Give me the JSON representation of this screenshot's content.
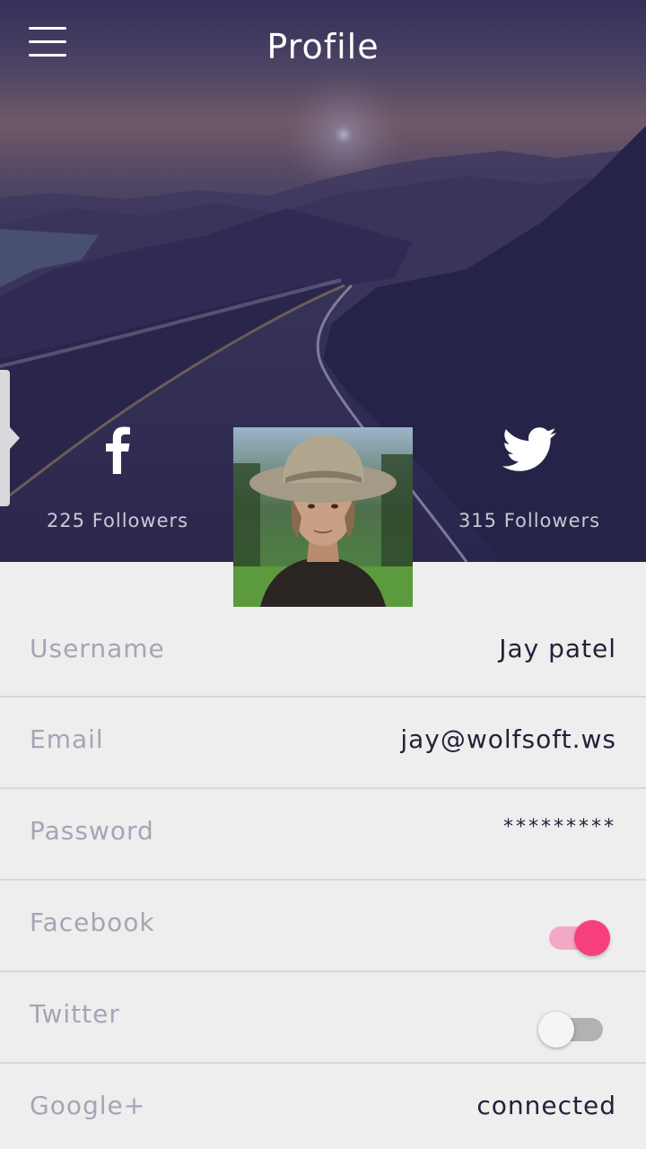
{
  "header": {
    "title": "Profile",
    "menu_icon": "hamburger-menu-icon"
  },
  "social": {
    "facebook": {
      "icon": "facebook-icon",
      "followers": "225 Followers"
    },
    "twitter": {
      "icon": "twitter-icon",
      "followers": "315 Followers"
    }
  },
  "profile": {
    "username_label": "Username",
    "username_value": "Jay patel",
    "email_label": "Email",
    "email_value": "jay@wolfsoft.ws",
    "password_label": "Password",
    "password_value": "*********",
    "facebook_label": "Facebook",
    "facebook_connected": true,
    "twitter_label": "Twitter",
    "twitter_connected": false,
    "google_label": "Google+",
    "google_value": "connected"
  },
  "colors": {
    "accent": "#f73f7f",
    "accent_light": "#f3a9c6",
    "label": "#a8a3b5",
    "value": "#24213a",
    "background": "#eeeeee"
  }
}
